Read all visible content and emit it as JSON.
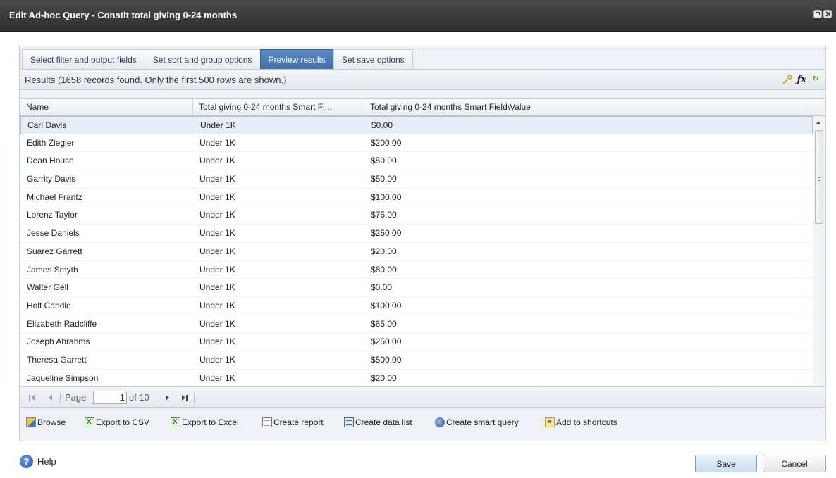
{
  "window": {
    "title": "Edit Ad-hoc Query - Constit total giving 0-24 months"
  },
  "tabs": [
    {
      "label": "Select filter and output fields",
      "active": false
    },
    {
      "label": "Set sort and group options",
      "active": false
    },
    {
      "label": "Preview results",
      "active": true
    },
    {
      "label": "Set save options",
      "active": false
    }
  ],
  "results": {
    "summary": "Results (1658 records found. Only the first 500 rows are shown.)",
    "toolbar_icons": [
      "key-icon",
      "formula-fx-icon",
      "refresh-icon"
    ]
  },
  "grid": {
    "columns": [
      "Name",
      "Total giving 0-24 months Smart Fi...",
      "Total giving 0-24 months Smart Field\\Value"
    ],
    "rows": [
      [
        "Carl Davis",
        "Under 1K",
        "$0.00"
      ],
      [
        "Edith Ziegler",
        "Under 1K",
        "$200.00"
      ],
      [
        "Dean House",
        "Under 1K",
        "$50.00"
      ],
      [
        "Garrity Davis",
        "Under 1K",
        "$50.00"
      ],
      [
        "Michael Frantz",
        "Under 1K",
        "$100.00"
      ],
      [
        "Lorenz Taylor",
        "Under 1K",
        "$75.00"
      ],
      [
        "Jesse Daniels",
        "Under 1K",
        "$250.00"
      ],
      [
        "Suarez Garrett",
        "Under 1K",
        "$20.00"
      ],
      [
        "James Smyth",
        "Under 1K",
        "$80.00"
      ],
      [
        "Walter Gell",
        "Under 1K",
        "$0.00"
      ],
      [
        "Holt Candle",
        "Under 1K",
        "$100.00"
      ],
      [
        "Elizabeth Radcliffe",
        "Under 1K",
        "$65.00"
      ],
      [
        "Joseph Abrahms",
        "Under 1K",
        "$250.00"
      ],
      [
        "Theresa Garrett",
        "Under 1K",
        "$500.00"
      ],
      [
        "Jaqueline Simpson",
        "Under 1K",
        "$20.00"
      ]
    ],
    "selected_row": 0
  },
  "pager": {
    "page_label": "Page",
    "page_value": "1",
    "of_label": "of 10"
  },
  "actions": [
    {
      "label": "Browse",
      "icon": "browse-icon"
    },
    {
      "label": "Export to CSV",
      "icon": "excel-icon"
    },
    {
      "label": "Export to Excel",
      "icon": "excel-icon"
    },
    {
      "label": "Create report",
      "icon": "report-icon"
    },
    {
      "label": "Create data list",
      "icon": "data-list-icon"
    },
    {
      "label": "Create smart query",
      "icon": "smart-query-icon"
    },
    {
      "label": "Add to shortcuts",
      "icon": "shortcut-icon"
    }
  ],
  "footer": {
    "help_label": "Help",
    "save_label": "Save",
    "cancel_label": "Cancel"
  }
}
